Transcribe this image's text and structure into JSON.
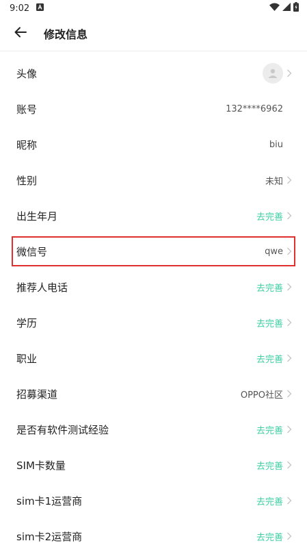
{
  "status_bar": {
    "time": "9:02"
  },
  "header": {
    "title": "修改信息"
  },
  "rows": [
    {
      "label": "头像",
      "value": "",
      "accent": false
    },
    {
      "label": "账号",
      "value": "132****6962",
      "accent": false
    },
    {
      "label": "昵称",
      "value": "biu",
      "accent": false
    },
    {
      "label": "性别",
      "value": "未知",
      "accent": false
    },
    {
      "label": "出生年月",
      "value": "去完善",
      "accent": true
    },
    {
      "label": "微信号",
      "value": "qwe",
      "accent": false
    },
    {
      "label": "推荐人电话",
      "value": "去完善",
      "accent": true
    },
    {
      "label": "学历",
      "value": "去完善",
      "accent": true
    },
    {
      "label": "职业",
      "value": "去完善",
      "accent": true
    },
    {
      "label": "招募渠道",
      "value": "OPPO社区",
      "accent": false
    },
    {
      "label": "是否有软件测试经验",
      "value": "去完善",
      "accent": true
    },
    {
      "label": "SIM卡数量",
      "value": "去完善",
      "accent": true
    },
    {
      "label": "sim卡1运营商",
      "value": "去完善",
      "accent": true
    },
    {
      "label": "sim卡2运营商",
      "value": "去完善",
      "accent": true
    }
  ],
  "colors": {
    "accent": "#3ecfa3",
    "highlight_border": "#e02f2f"
  }
}
